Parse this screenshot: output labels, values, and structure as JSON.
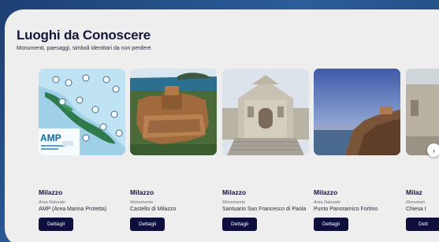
{
  "section": {
    "title": "Luoghi da Conoscere",
    "subtitle": "Monumenti, paesaggi, simboli identitari da non perdere."
  },
  "cards": [
    {
      "city": "Milazzo",
      "category": "Area Naturale",
      "name": "AMP (Area Marina Protetta)",
      "button": "Dettagli",
      "image_logo_text": "AMP"
    },
    {
      "city": "Milazzo",
      "category": "Monumento",
      "name": "Castello di Milazzo",
      "button": "Dettagli"
    },
    {
      "city": "Milazzo",
      "category": "Monumento",
      "name": "Santuario San Francesco di Paola",
      "button": "Dettagli"
    },
    {
      "city": "Milazzo",
      "category": "Area Naturale",
      "name": "Punto Panoramico Fortino",
      "button": "Dettagli"
    },
    {
      "city": "Milaz",
      "category": "Monumen",
      "name": "Chiesa I",
      "button": "Dett"
    }
  ],
  "carousel": {
    "next_icon": "›"
  }
}
